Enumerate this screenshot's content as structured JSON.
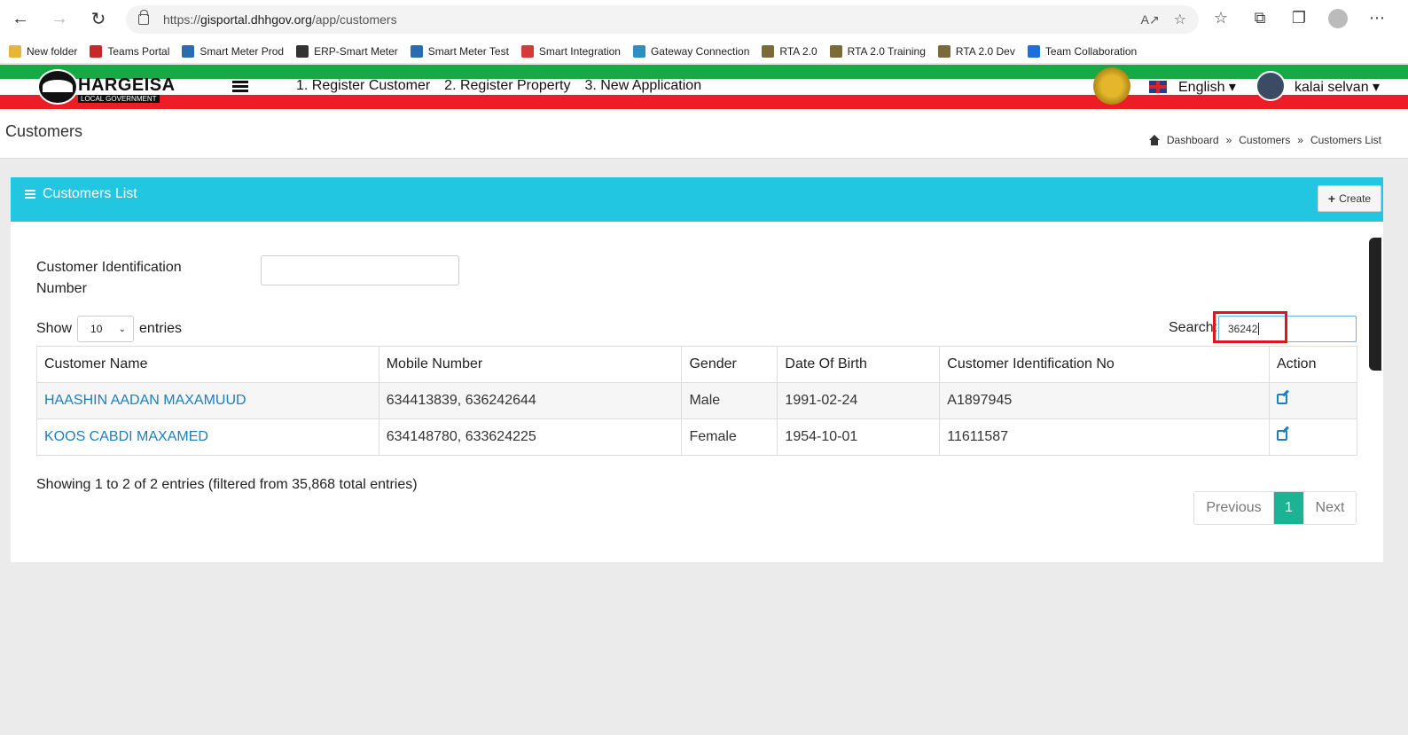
{
  "browser": {
    "url_prefix": "https://",
    "url_host": "gisportal.dhhgov.org",
    "url_path": "/app/customers",
    "bookmarks": [
      {
        "label": "New folder",
        "color": "#e7b53a"
      },
      {
        "label": "Teams Portal",
        "color": "#c42a2a"
      },
      {
        "label": "Smart Meter Prod",
        "color": "#2b6cb0"
      },
      {
        "label": "ERP-Smart Meter",
        "color": "#333333"
      },
      {
        "label": "Smart Meter Test",
        "color": "#2b6cb0"
      },
      {
        "label": "Smart Integration",
        "color": "#d33a3a"
      },
      {
        "label": "Gateway Connection",
        "color": "#2c8fbf"
      },
      {
        "label": "RTA 2.0",
        "color": "#7a6a3a"
      },
      {
        "label": "RTA 2.0 Training",
        "color": "#7a6a3a"
      },
      {
        "label": "RTA 2.0 Dev",
        "color": "#7a6a3a"
      },
      {
        "label": "Team Collaboration",
        "color": "#1e6fd9"
      }
    ]
  },
  "header": {
    "logo_text": "HARGEISA",
    "logo_sub": "LOCAL GOVERNMENT",
    "menu": [
      "1. Register Customer",
      "2. Register Property",
      "3. New Application"
    ],
    "language": "English ▾",
    "user_name": "kalai selvan ▾"
  },
  "page": {
    "title": "Customers",
    "breadcrumb": [
      "Dashboard",
      "Customers",
      "Customers List"
    ]
  },
  "panel": {
    "title": "Customers List",
    "create_label": "Create",
    "cid_label": "Customer Identification Number",
    "show_label": "Show",
    "entries_value": "10",
    "entries_label": "entries",
    "search_label": "Search:",
    "search_value": "36242"
  },
  "table": {
    "headers": [
      "Customer Name",
      "Mobile Number",
      "Gender",
      "Date Of Birth",
      "Customer Identification No",
      "Action"
    ],
    "rows": [
      {
        "name": "HAASHIN AADAN MAXAMUUD",
        "mobile": "634413839, 636242644",
        "gender": "Male",
        "dob": "1991-02-24",
        "cid": "A1897945"
      },
      {
        "name": "KOOS CABDI MAXAMED",
        "mobile": "634148780, 633624225",
        "gender": "Female",
        "dob": "1954-10-01",
        "cid": "11611587"
      }
    ]
  },
  "footer": {
    "showing": "Showing 1 to 2 of 2 entries (filtered from 35,868 total entries)",
    "prev": "Previous",
    "page": "1",
    "next": "Next"
  },
  "colors": {
    "panel_head": "#23c6e1",
    "link": "#1a7fbf",
    "active_page": "#1ab394",
    "highlight": "#e0141e"
  }
}
